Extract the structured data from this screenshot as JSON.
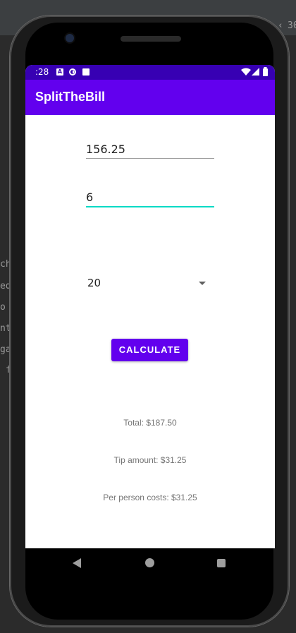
{
  "ide": {
    "corner_text": "30",
    "fragments": [
      "ch",
      "ed",
      "o",
      "nt",
      "ga",
      "f"
    ]
  },
  "status_bar": {
    "time": ":28",
    "icons": [
      "a-notification-icon",
      "sync-icon",
      "sd-card-icon",
      "wifi-icon",
      "signal-icon",
      "battery-icon"
    ]
  },
  "app": {
    "title": "SplitTheBill",
    "bill_amount": "156.25",
    "party_size": "6",
    "tip_percent": "20",
    "calculate_label": "CALCULATE",
    "total_text": "Total: $187.50",
    "tip_text": "Tip amount: $31.25",
    "per_person_text": "Per person costs: $31.25"
  },
  "nav": {
    "back": "back-icon",
    "home": "home-icon",
    "recents": "recents-icon"
  },
  "colors": {
    "status_bar": "#3700b3",
    "app_bar": "#6200ee",
    "accent": "#03dac5",
    "button": "#6200ee"
  }
}
